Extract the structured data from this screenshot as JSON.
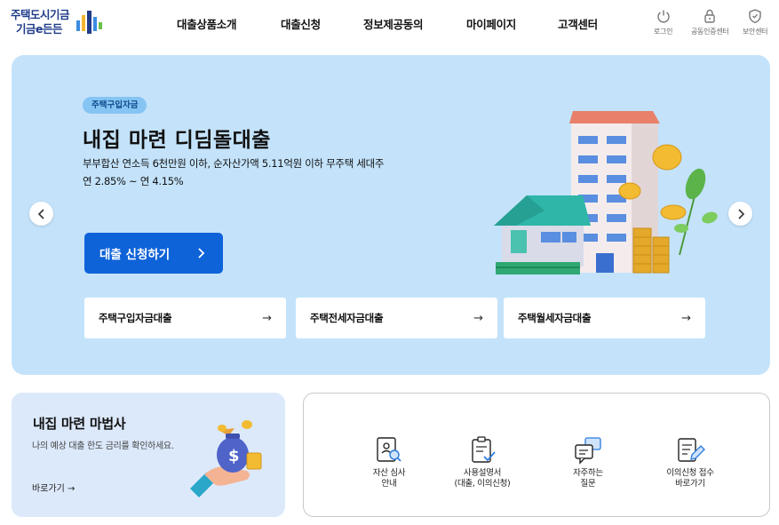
{
  "header": {
    "logo_line1": "주택도시기금",
    "logo_line2": "기금e든든",
    "nav": [
      "대출상품소개",
      "대출신청",
      "정보제공동의",
      "마이페이지",
      "고객센터"
    ],
    "utils": [
      {
        "label": "로그인",
        "icon": "power-icon"
      },
      {
        "label": "공동인증센터",
        "icon": "lock-icon"
      },
      {
        "label": "보안센터",
        "icon": "shield-icon"
      }
    ]
  },
  "hero": {
    "tag": "주택구입자금",
    "title": "내집 마련 디딤돌대출",
    "desc_line1": "부부합산 연소득 6천만원 이하, 순자산가액 5.11억원 이하 무주택 세대주",
    "desc_line2": "연 2.85% ~ 연 4.15%",
    "apply_label": "대출 신청하기",
    "quick_links": [
      "주택구입자금대출",
      "주택전세자금대출",
      "주택월세자금대출"
    ]
  },
  "wizard": {
    "title": "내집 마련 마법사",
    "desc": "나의 예상 대출 한도 금리를 확인하세요.",
    "link": "바로가기 →"
  },
  "services": [
    {
      "line1": "자산 심사",
      "line2": "안내",
      "icon": "asset-review-icon"
    },
    {
      "line1": "사용설명서",
      "line2": "(대출, 이의신청)",
      "icon": "manual-icon"
    },
    {
      "line1": "자주하는",
      "line2": "질문",
      "icon": "faq-icon"
    },
    {
      "line1": "이의신청 접수",
      "line2": "바로가기",
      "icon": "objection-icon"
    }
  ],
  "colors": {
    "brand": "#1f3c8a",
    "hero_bg": "#c4e3fb",
    "primary_button": "#0f63d9",
    "wizard_bg": "#dce9fb"
  }
}
